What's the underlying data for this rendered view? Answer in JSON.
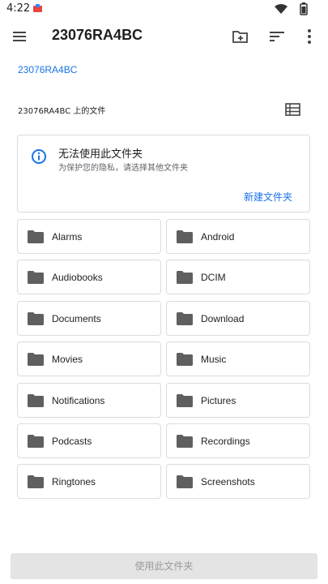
{
  "status_bar": {
    "time": "4:22",
    "notification_icon": "app-notification-icon",
    "wifi_icon": "wifi-icon",
    "battery_icon": "battery-icon"
  },
  "app_bar": {
    "title": "23076RA4BC",
    "menu_icon": "menu-icon",
    "new_folder_icon": "create-new-folder-icon",
    "sort_icon": "sort-icon",
    "more_icon": "more-vert-icon"
  },
  "breadcrumb": "23076RA4BC",
  "section": {
    "label": "23076RA4BC 上的文件",
    "view_toggle_icon": "list-view-icon"
  },
  "info_card": {
    "icon": "info-icon",
    "title": "无法使用此文件夹",
    "subtitle": "为保护您的隐私，请选择其他文件夹",
    "action": "新建文件夹"
  },
  "folders": [
    "Alarms",
    "Android",
    "Audiobooks",
    "DCIM",
    "Documents",
    "Download",
    "Movies",
    "Music",
    "Notifications",
    "Pictures",
    "Podcasts",
    "Recordings",
    "Ringtones",
    "Screenshots"
  ],
  "bottom_button": {
    "label": "使用此文件夹",
    "enabled": false
  },
  "colors": {
    "accent": "#1a73e8",
    "folder_icon": "#5f5f5f",
    "border": "#dadce0",
    "disabled_bg": "#e4e4e4"
  }
}
